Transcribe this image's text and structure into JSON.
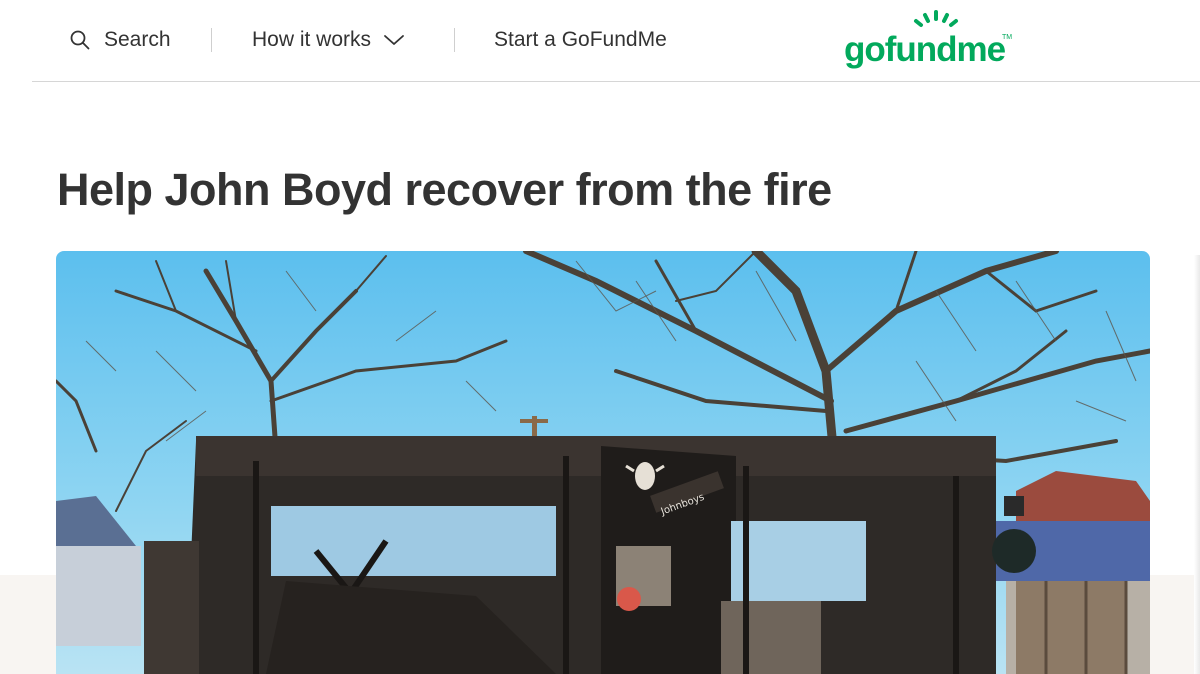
{
  "header": {
    "search_label": "Search",
    "how_it_works_label": "How it works",
    "start_label": "Start a GoFundMe",
    "logo_text": "gofundme",
    "logo_tm": "TM"
  },
  "campaign": {
    "title": "Help John Boyd recover from the fire",
    "image_sign_text": "Johnboys"
  },
  "colors": {
    "brand_green": "#02a95c",
    "text": "#333333",
    "sky": "#6fc8ee"
  },
  "icons": [
    "search-icon",
    "chevron-down-icon",
    "gofundme-logo"
  ]
}
